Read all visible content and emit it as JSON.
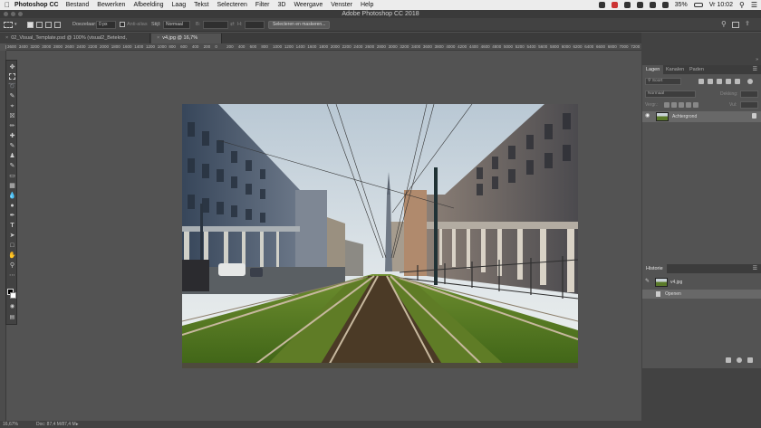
{
  "menubar": {
    "app_name": "Photoshop CC",
    "items": [
      "Bestand",
      "Bewerken",
      "Afbeelding",
      "Laag",
      "Tekst",
      "Selecteren",
      "Filter",
      "3D",
      "Weergave",
      "Venster",
      "Help"
    ],
    "battery": "35%",
    "clock": "Vr 10:02"
  },
  "window": {
    "title": "Adobe Photoshop CC 2018"
  },
  "options": {
    "feather_label": "Doezelaar:",
    "feather_value": "0 px",
    "antialias_label": "Anti-alias",
    "style_label": "Stijl:",
    "style_value": "Normaal",
    "width_label": "B:",
    "height_label": "H:",
    "select_mask_button": "Selecteren en maskeren..."
  },
  "doc_tabs": [
    {
      "label": "02_Visual_Template.psd @ 100% (visual2_Beteknd, RGB/8*) *",
      "active": false
    },
    {
      "label": "v4.jpg @ 16,7% (RGB/8)",
      "active": true
    }
  ],
  "ruler": {
    "labels": [
      "3600",
      "3400",
      "3200",
      "3000",
      "2800",
      "2600",
      "2400",
      "2200",
      "2000",
      "1800",
      "1600",
      "1400",
      "1200",
      "1000",
      "800",
      "600",
      "400",
      "200",
      "0",
      "200",
      "400",
      "600",
      "800",
      "1000",
      "1200",
      "1400",
      "1600",
      "1800",
      "2000",
      "2200",
      "2400",
      "2600",
      "2800",
      "3000",
      "3200",
      "3400",
      "3600",
      "3800",
      "4000",
      "4200",
      "4400",
      "4600",
      "4800",
      "5000",
      "5200",
      "5400",
      "5600",
      "5800",
      "6000",
      "6200",
      "6400",
      "6600",
      "6800",
      "7000",
      "7200"
    ]
  },
  "status": {
    "zoom": "16,67%",
    "doc_size": "Doc: 87,4 M/87,4 M"
  },
  "layers_panel": {
    "tabs": [
      "Lagen",
      "Kanalen",
      "Paden"
    ],
    "search_placeholder": "Soort",
    "blend_mode": "Normaal",
    "opacity_label": "Dekking:",
    "lock_label": "Vergr.:",
    "fill_label": "Vul:",
    "layers": [
      {
        "name": "Achtergrond"
      }
    ]
  },
  "history_panel": {
    "tab": "Historie",
    "source": "v4.jpg",
    "states": [
      "Openen"
    ]
  },
  "colors": {
    "accent": "#1473e6",
    "panel_bg": "#535353",
    "dark_bg": "#424242"
  }
}
